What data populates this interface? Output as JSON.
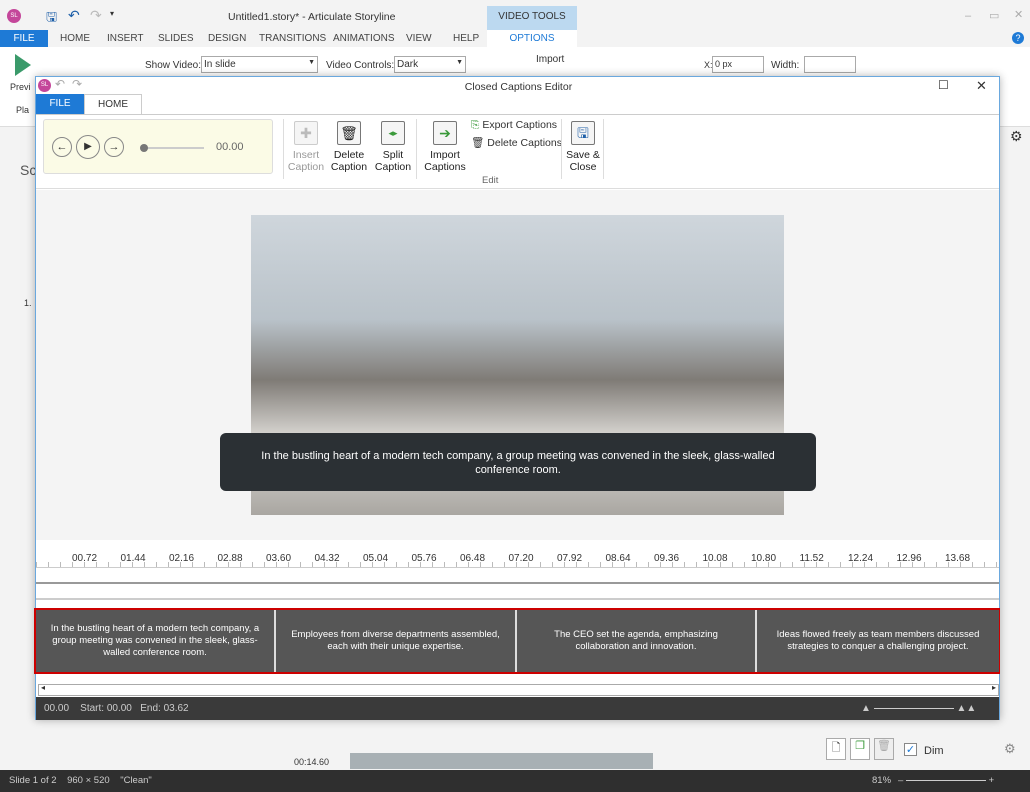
{
  "app": {
    "title": "Untitled1.story* - Articulate Storyline",
    "logo": "SL",
    "context_tab_group": "VIDEO TOOLS",
    "tabs": [
      "FILE",
      "HOME",
      "INSERT",
      "SLIDES",
      "DESIGN",
      "TRANSITIONS",
      "ANIMATIONS",
      "VIEW",
      "HELP",
      "OPTIONS"
    ],
    "ribbon": {
      "preview": "Previ",
      "play": "Pla",
      "show_video_label": "Show Video:",
      "show_video_value": "In slide",
      "video_controls_label": "Video Controls:",
      "video_controls_value": "Dark",
      "import": "Import",
      "x_label": "X:",
      "x_value": "0 px",
      "width_label": "Width:"
    },
    "side_label": "Sc",
    "slide_num": "1.",
    "timeline_time": "00:14.60",
    "panel": {
      "dim_label": "Dim",
      "dim_checked": true
    },
    "status": {
      "slide": "Slide 1 of 2",
      "size": "960 × 520",
      "theme": "\"Clean\"",
      "zoom": "81%"
    }
  },
  "dialog": {
    "title": "Closed Captions Editor",
    "logo": "SL",
    "tabs": [
      "FILE",
      "HOME"
    ],
    "player": {
      "time": "00.00"
    },
    "buttons": {
      "insert": "Insert Caption",
      "delete": "Delete Caption",
      "split": "Split Caption",
      "import": "Import Captions",
      "export": "Export Captions",
      "delete_all": "Delete Captions",
      "save": "Save & Close"
    },
    "group_label": "Edit",
    "overlay_caption": "In the bustling heart of a modern tech company, a group meeting was convened in the sleek, glass-walled conference room.",
    "ruler": [
      "00.72",
      "01.44",
      "02.16",
      "02.88",
      "03.60",
      "04.32",
      "05.04",
      "05.76",
      "06.48",
      "07.20",
      "07.92",
      "08.64",
      "09.36",
      "10.08",
      "10.80",
      "11.52",
      "12.24",
      "12.96",
      "13.68"
    ],
    "captions": [
      "In the bustling heart of a modern tech company, a group meeting was convened in the sleek, glass-walled conference room.",
      "Employees from diverse departments assembled, each with their unique expertise.",
      "The CEO set the agenda, emphasizing collaboration and innovation.",
      "Ideas flowed freely as team members discussed strategies to conquer a challenging project."
    ],
    "footer": {
      "time": "00.00",
      "start_label": "Start:",
      "start": "00.00",
      "end_label": "End:",
      "end": "03.62"
    }
  },
  "colors": {
    "accent": "#1e7ad6",
    "selection": "#cc0000",
    "caption_bg": "#565656",
    "footer_bg": "#3a3a3a"
  }
}
